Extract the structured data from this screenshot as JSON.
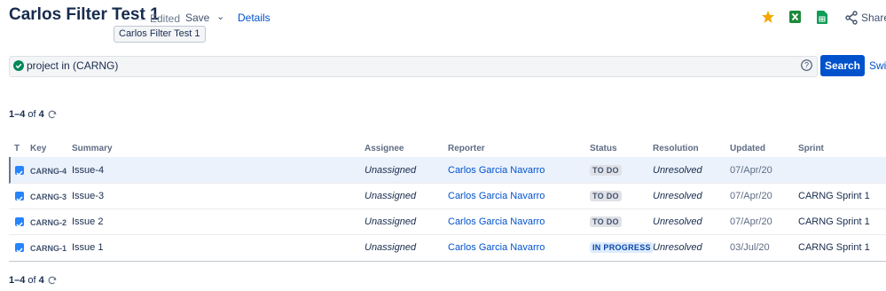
{
  "header": {
    "title": "Carlos Filter Test 1",
    "edited": "Edited",
    "save": "Save",
    "details": "Details",
    "tooltip": "Carlos Filter Test 1",
    "share": "Share"
  },
  "search": {
    "query": "project in (CARNG)",
    "button": "Search",
    "switch_label": "Swit"
  },
  "pagination": {
    "range": "1–4",
    "of": "of",
    "total": "4"
  },
  "table": {
    "headers": {
      "type": "T",
      "key": "Key",
      "summary": "Summary",
      "assignee": "Assignee",
      "reporter": "Reporter",
      "status": "Status",
      "resolution": "Resolution",
      "updated": "Updated",
      "sprint": "Sprint"
    },
    "rows": [
      {
        "key": "CARNG-4",
        "summary": "Issue-4",
        "assignee": "Unassigned",
        "reporter": "Carlos Garcia Navarro",
        "status": "TO DO",
        "resolution": "Unresolved",
        "updated": "07/Apr/20",
        "sprint": ""
      },
      {
        "key": "CARNG-3",
        "summary": "Issue-3",
        "assignee": "Unassigned",
        "reporter": "Carlos Garcia Navarro",
        "status": "TO DO",
        "resolution": "Unresolved",
        "updated": "07/Apr/20",
        "sprint": "CARNG Sprint 1"
      },
      {
        "key": "CARNG-2",
        "summary": "Issue 2",
        "assignee": "Unassigned",
        "reporter": "Carlos Garcia Navarro",
        "status": "TO DO",
        "resolution": "Unresolved",
        "updated": "07/Apr/20",
        "sprint": "CARNG Sprint 1"
      },
      {
        "key": "CARNG-1",
        "summary": "Issue 1",
        "assignee": "Unassigned",
        "reporter": "Carlos Garcia Navarro",
        "status": "IN PROGRESS",
        "resolution": "Unresolved",
        "updated": "03/Jul/20",
        "sprint": "CARNG Sprint 1"
      }
    ]
  },
  "colors": {
    "primary": "#0052cc",
    "star": "#f6a700",
    "excel": "#1d8a3b",
    "sheets": "#0f9d58",
    "status_done_bg": "#dfe1e6",
    "status_progress_bg": "#deebff",
    "ok": "#00875a"
  },
  "icons": [
    "star-icon",
    "excel-icon",
    "google-sheets-icon",
    "share-icon",
    "check-circle-icon",
    "help-icon",
    "refresh-icon",
    "issue-type-task-icon",
    "chevron-down-icon"
  ]
}
